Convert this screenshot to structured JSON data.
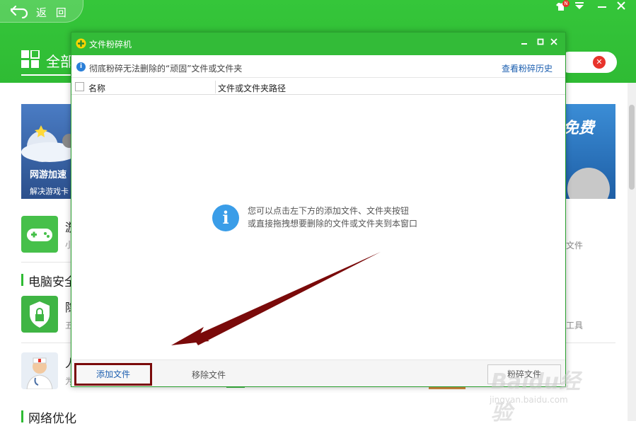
{
  "header": {
    "back_label": "返 回",
    "title": "全部",
    "badge": "N"
  },
  "banner": {
    "left_title": "网游加速",
    "left_subtitle": "解决游戏卡",
    "right_text": "免费"
  },
  "sections": [
    {
      "title": "电脑安全"
    },
    {
      "title": "网络优化"
    }
  ],
  "apps": [
    {
      "name": "游",
      "desc": "小",
      "side": "文件"
    },
    {
      "name": "隐",
      "desc": "五",
      "side": "工具"
    },
    {
      "name": "人",
      "desc": "为",
      "side": ""
    }
  ],
  "dialog": {
    "title": "文件粉碎机",
    "info_text": "彻底粉碎无法删除的“顽固”文件或文件夹",
    "history_link": "查看粉碎历史",
    "columns": [
      "名称",
      "文件或文件夹路径"
    ],
    "hint_line1": "您可以点击左下方的添加文件、文件夹按钮",
    "hint_line2": "或直接拖拽想要删除的文件或文件夹到本窗口",
    "add_file": "添加文件",
    "remove_file": "移除文件",
    "shred_file": "粉碎文件"
  },
  "watermark": {
    "text": "Baidu经验",
    "url": "jingyan.baidu.com"
  },
  "colors": {
    "brand_green": "#33bb38",
    "annotation": "#7a0a0a",
    "link_blue": "#1c5fb0"
  }
}
